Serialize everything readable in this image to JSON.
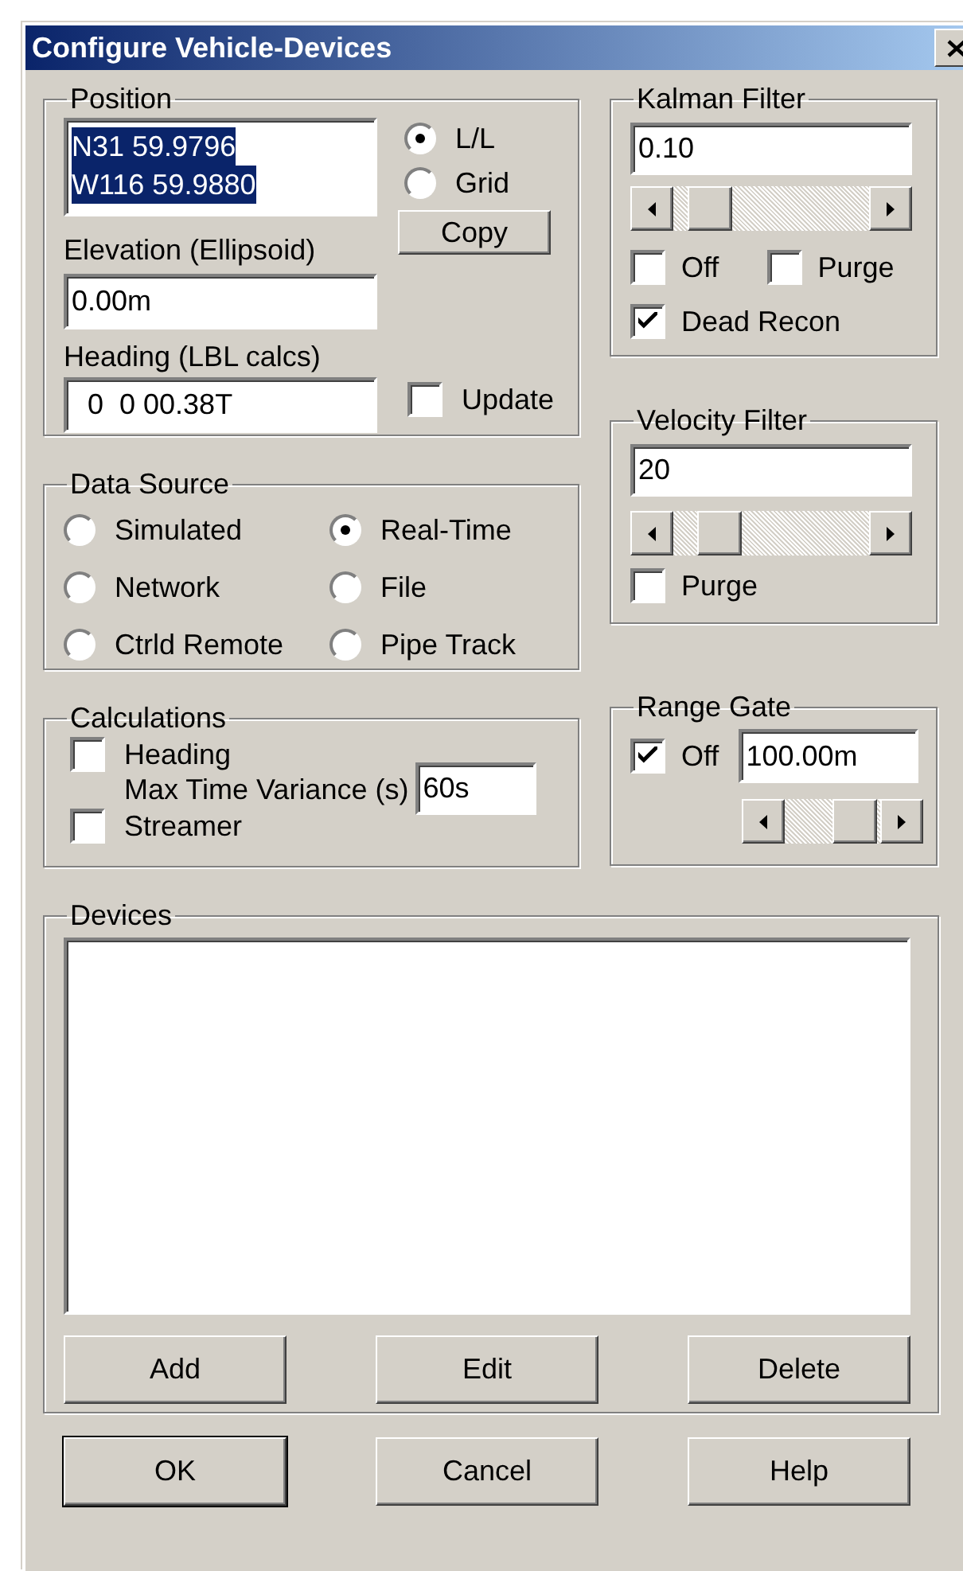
{
  "window": {
    "title": "Configure Vehicle-Devices"
  },
  "position": {
    "title": "Position",
    "coordinates": [
      "N31 59.9796",
      "W116 59.9880"
    ],
    "coordinates_highlighted": true,
    "modes": [
      {
        "label": "L/L",
        "selected": true
      },
      {
        "label": "Grid",
        "selected": false
      }
    ],
    "copy_button": "Copy",
    "elevation": {
      "label": "Elevation (Ellipsoid)",
      "value": "0.00m"
    },
    "heading": {
      "label": "Heading (LBL calcs)",
      "value": "  0  0 00.38T"
    },
    "update": {
      "label": "Update",
      "checked": false
    }
  },
  "data_source": {
    "title": "Data Source",
    "options": [
      {
        "label": "Simulated",
        "selected": false
      },
      {
        "label": "Real-Time",
        "selected": true
      },
      {
        "label": "Network",
        "selected": false
      },
      {
        "label": "File",
        "selected": false
      },
      {
        "label": "Ctrld Remote",
        "selected": false
      },
      {
        "label": "Pipe Track",
        "selected": false
      }
    ]
  },
  "calculations": {
    "title": "Calculations",
    "heading": {
      "label": "Heading",
      "checked": false
    },
    "max_time_variance": {
      "label": "Max Time Variance (s)",
      "value": "60s"
    },
    "streamer": {
      "label": "Streamer",
      "checked": false
    }
  },
  "kalman_filter": {
    "title": "Kalman Filter",
    "value": "0.10",
    "slider": {
      "level": 0.09
    },
    "off": {
      "label": "Off",
      "checked": false
    },
    "purge": {
      "label": "Purge",
      "checked": false
    },
    "dead_recon": {
      "label": "Dead Recon",
      "checked": true
    }
  },
  "velocity_filter": {
    "title": "Velocity Filter",
    "value": "20",
    "slider": {
      "level": 0.16
    },
    "purge": {
      "label": "Purge",
      "checked": false
    }
  },
  "range_gate": {
    "title": "Range Gate",
    "off": {
      "label": "Off",
      "checked": true
    },
    "value": "100.00m",
    "slider": {
      "level": 0.95
    }
  },
  "devices": {
    "title": "Devices",
    "buttons": [
      "Add",
      "Edit",
      "Delete"
    ]
  },
  "buttons": [
    {
      "label": "OK",
      "default": true
    },
    {
      "label": "Cancel",
      "default": false
    },
    {
      "label": "Help",
      "default": false
    }
  ]
}
